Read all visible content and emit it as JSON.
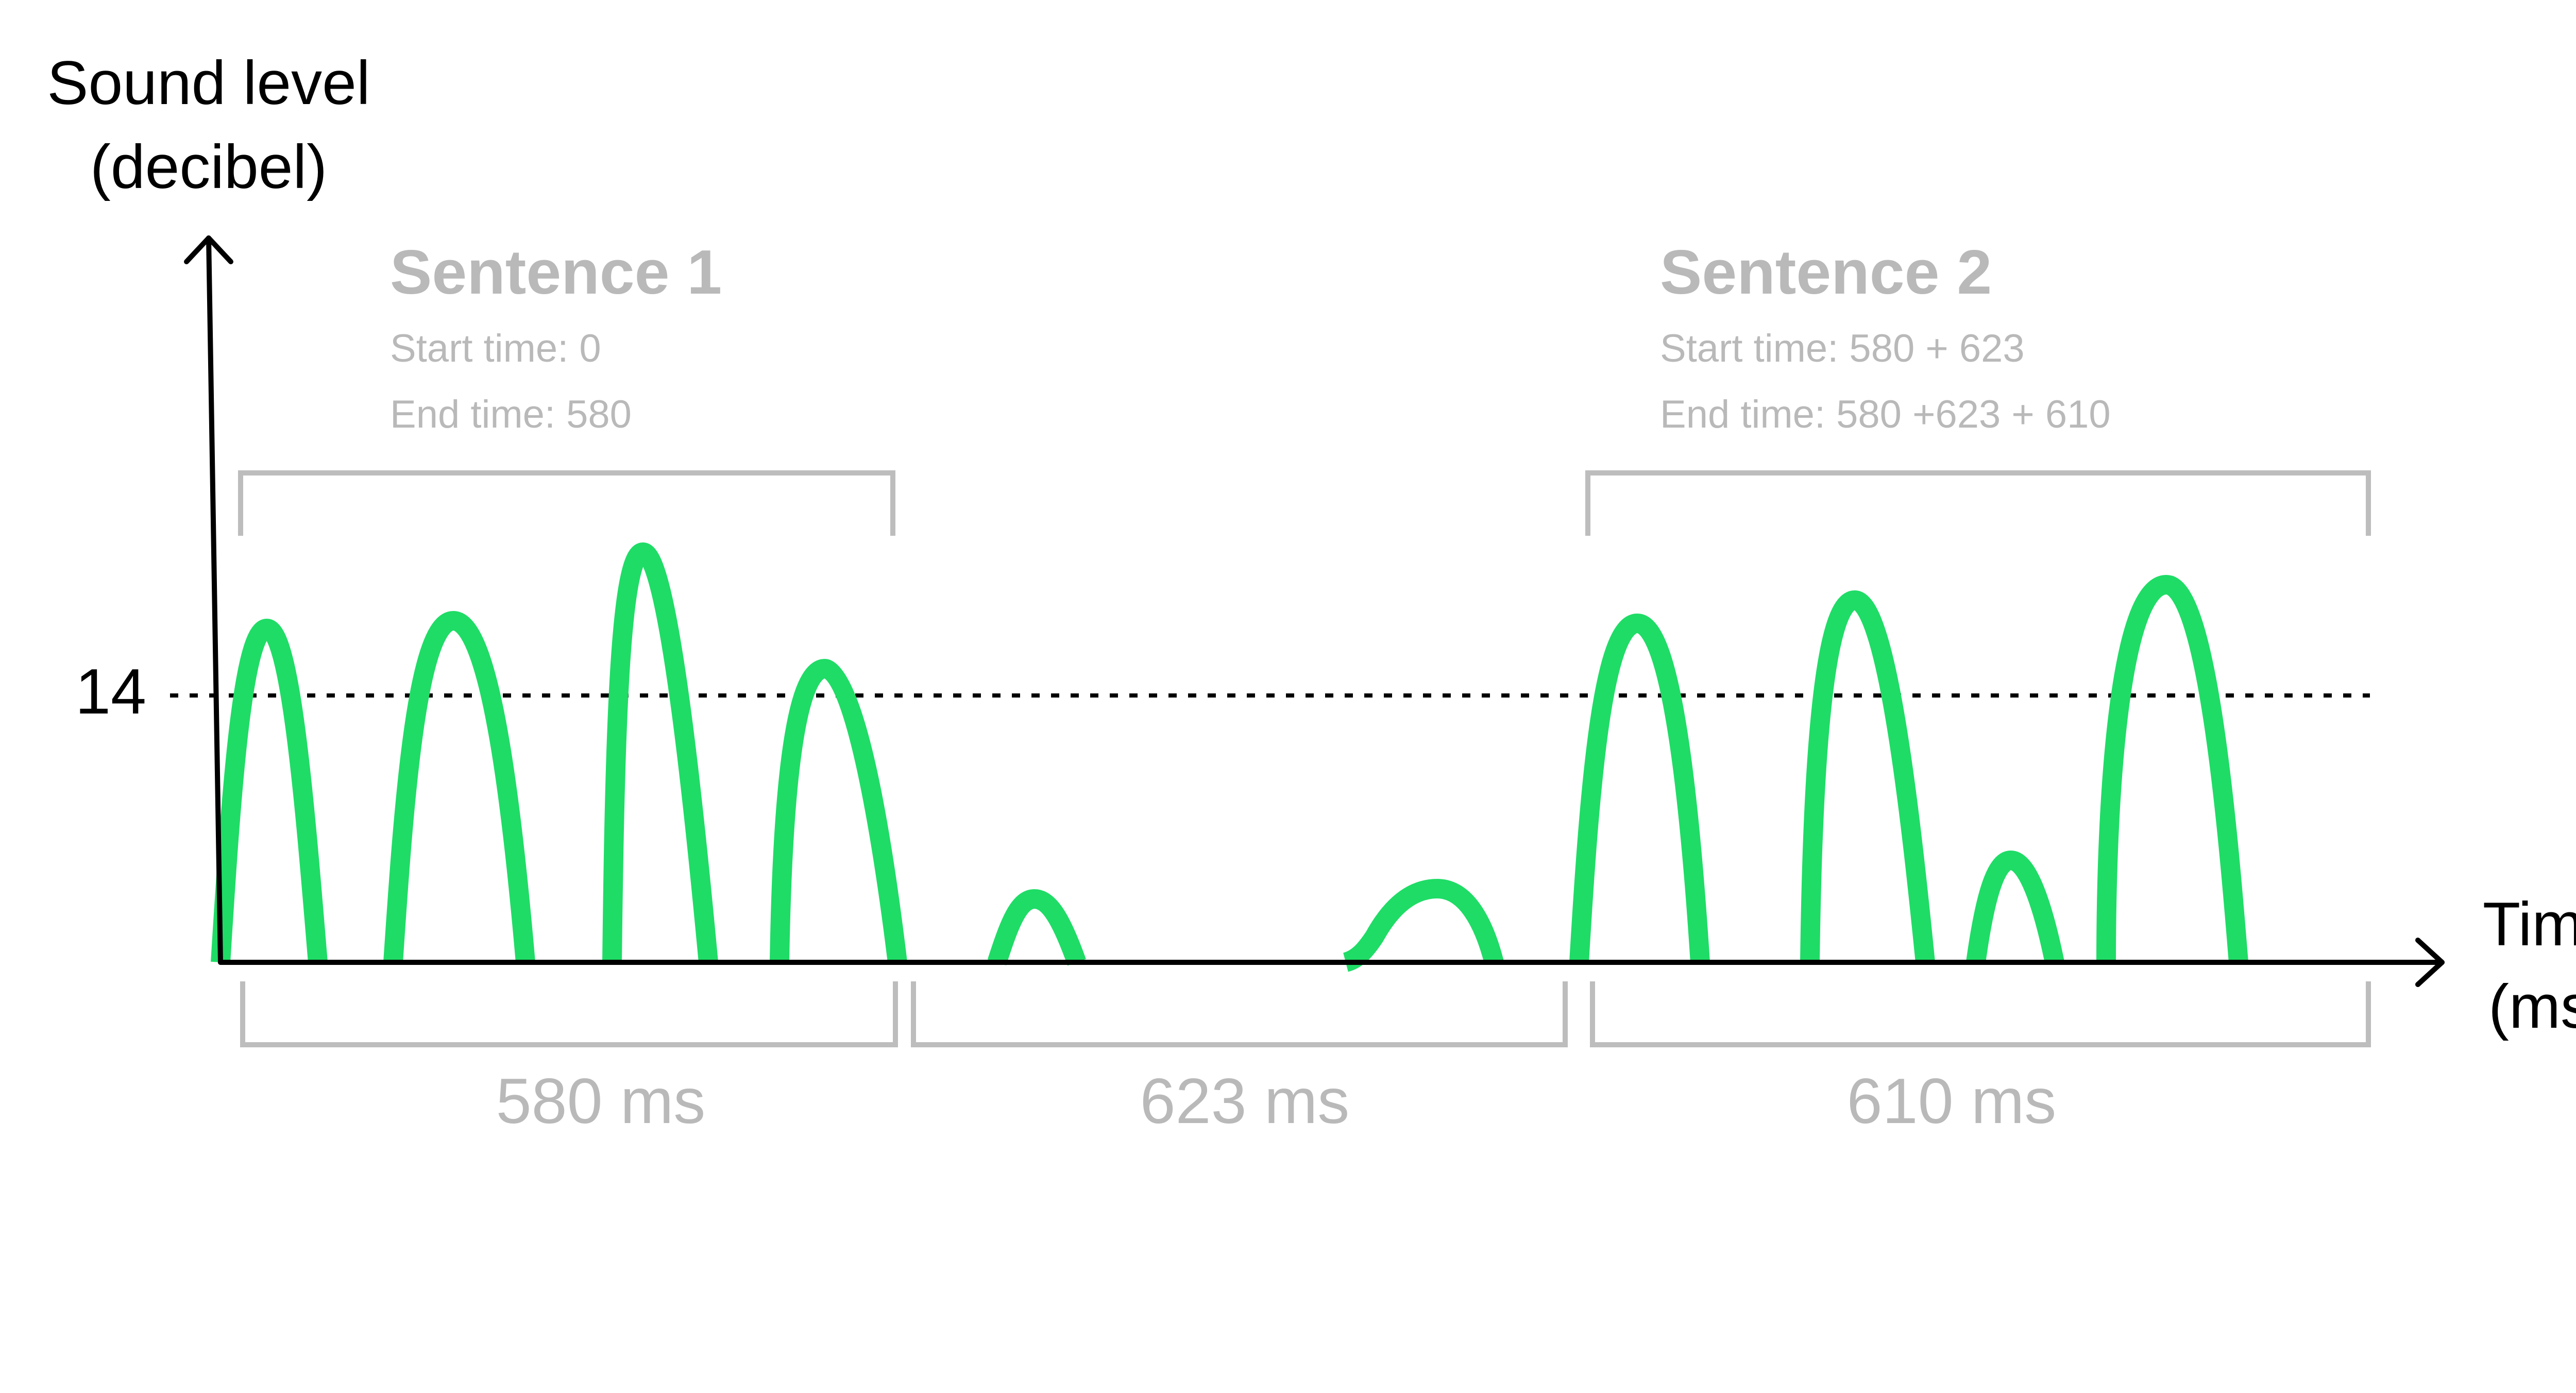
{
  "y_axis": {
    "label_line1": "Sound level",
    "label_line2": "(decibel)",
    "threshold_tick": "14"
  },
  "x_axis": {
    "label_line1": "Time",
    "label_line2": "(ms)"
  },
  "sentences": [
    {
      "title": "Sentence 1",
      "start": "Start time: 0",
      "end": "End time: 580"
    },
    {
      "title": "Sentence 2",
      "start": "Start time: 580 + 623",
      "end": "End time: 580 +623 + 610"
    }
  ],
  "durations": [
    "580 ms",
    "623 ms",
    "610 ms"
  ],
  "colors": {
    "wave": "#1fdc66",
    "annotation": "#b9b9b9",
    "axis": "#000000"
  }
}
